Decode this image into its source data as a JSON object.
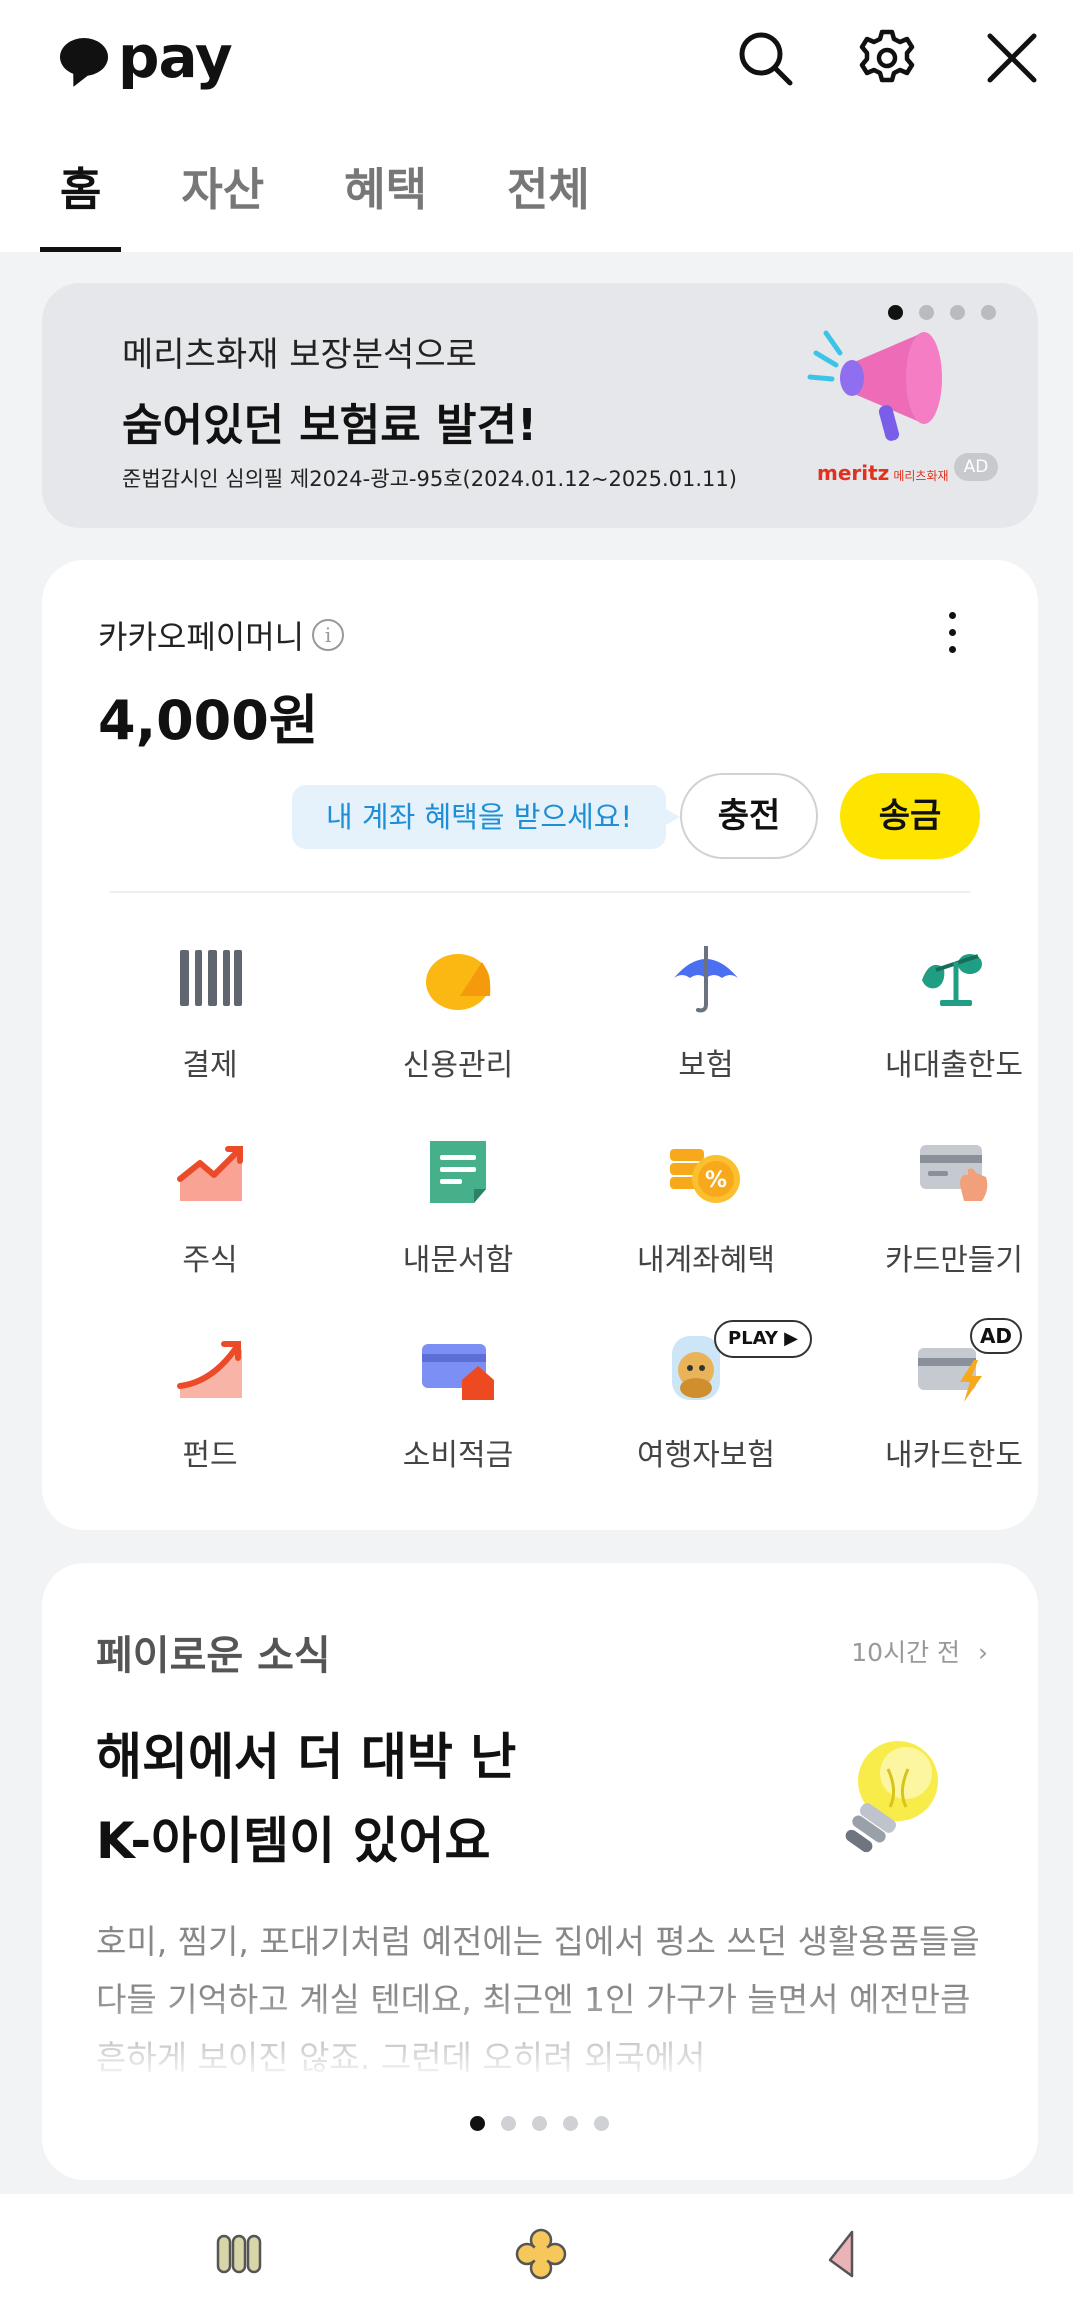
{
  "app": {
    "logo_text": "pay"
  },
  "header": {
    "icons": [
      "search-icon",
      "gear-icon",
      "close-icon"
    ]
  },
  "tabs": [
    {
      "label": "홈",
      "active": true
    },
    {
      "label": "자산",
      "active": false
    },
    {
      "label": "혜택",
      "active": false
    },
    {
      "label": "전체",
      "active": false
    }
  ],
  "banner": {
    "line1": "메리츠화재 보장분석으로",
    "line2": "숨어있던 보험료 발견!",
    "line3": "준법감시인 심의필 제2024-광고-95호(2024.01.12~2025.01.11)",
    "brand": "meritz",
    "brand_sub": "메리츠화재",
    "ad_label": "AD",
    "page_index": 1,
    "page_count": 4
  },
  "money": {
    "title": "카카오페이머니",
    "info_icon": "i",
    "balance": "4,000원",
    "promo": "내 계좌 혜택을 받으세요!",
    "charge_label": "충전",
    "send_label": "송금"
  },
  "menu": [
    {
      "label": "결제",
      "icon": "barcode-icon"
    },
    {
      "label": "신용관리",
      "icon": "credit-score-icon"
    },
    {
      "label": "보험",
      "icon": "umbrella-icon"
    },
    {
      "label": "내대출한도",
      "icon": "scale-icon"
    },
    {
      "label": "주식",
      "icon": "stock-chart-icon"
    },
    {
      "label": "내문서함",
      "icon": "document-icon"
    },
    {
      "label": "내계좌혜택",
      "icon": "coin-percent-icon"
    },
    {
      "label": "카드만들기",
      "icon": "card-hand-icon"
    },
    {
      "label": "펀드",
      "icon": "fund-chart-icon"
    },
    {
      "label": "소비적금",
      "icon": "card-house-icon"
    },
    {
      "label": "여행자보험",
      "icon": "travel-character-icon",
      "badge": "PLAY ▶"
    },
    {
      "label": "내카드한도",
      "icon": "card-bolt-icon",
      "badge": "AD"
    }
  ],
  "news": {
    "heading": "페이로운 소식",
    "time": "10시간 전",
    "title_line1": "해외에서 더 대박 난",
    "title_line2": "K-아이템이 있어요",
    "body": "호미, 찜기, 포대기처럼 예전에는 집에서 평소 쓰던 생활용품들을 다들 기억하고 계실 텐데요, 최근엔 1인 가구가 늘면서 예전만큼 흔하게 보이진 않죠. 그런데 오히려 외국에서",
    "page_index": 1,
    "page_count": 5
  },
  "bottom_nav": {
    "icons": [
      "wallet-icon",
      "clover-icon",
      "pinwheel-icon"
    ]
  },
  "colors": {
    "kakao_yellow": "#fee500",
    "promo_blue": "#1e8fd6",
    "meritz_red": "#e0321f"
  }
}
